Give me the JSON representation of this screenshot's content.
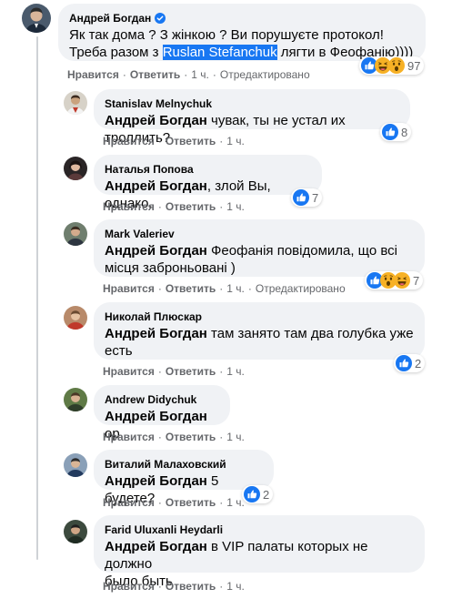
{
  "actions": {
    "like": "Нравится",
    "reply": "Ответить",
    "sep": "·",
    "edited": "Отредактировано"
  },
  "colors": {
    "like_blue": "#1877f2",
    "haha_yellow": "#f7b125",
    "bubble": "#f0f2f5",
    "meta_gray": "#65676b"
  },
  "comments": [
    {
      "author": "Андрей Богдан",
      "verified": true,
      "line1": "Як так дома ? З жінкою ? Ви порушуєте протокол!",
      "line2_before": "Треба разом з ",
      "tag": "Ruslan Stefanchuk",
      "line2_after": " лягти в Феофанію))))",
      "time": "1 ч.",
      "reactions": [
        "like-icon",
        "haha-icon",
        "wow-icon"
      ],
      "count": "97"
    },
    {
      "author": "Stanislav Melnychuk",
      "mention": "Андрей Богдан",
      "text": " чувак, ты не устал их троллить?",
      "time": "1 ч.",
      "reactions": [
        "like-icon"
      ],
      "count": "8"
    },
    {
      "author": "Наталья Попова",
      "mention": "Андрей Богдан",
      "text": ", злой Вы, однако.",
      "time": "1 ч.",
      "reactions": [
        "like-icon"
      ],
      "count": "7"
    },
    {
      "author": "Mark Valeriev",
      "mention": "Андрей Богдан",
      "text_line1": " Феофанія повідомила, що всі",
      "text_line2": "місця заброньовані )",
      "time": "1 ч.",
      "reactions": [
        "like-icon",
        "wow-icon",
        "haha-icon"
      ],
      "count": "7"
    },
    {
      "author": "Николай Плюскар",
      "mention": "Андрей Богдан",
      "text_line1": " там занято там два голубка уже",
      "text_line2": "есть",
      "time": "1 ч.",
      "reactions": [
        "like-icon"
      ],
      "count": "2"
    },
    {
      "author": "Andrew Didychuk",
      "mention": "Андрей Богдан",
      "text": " ор",
      "time": "1 ч."
    },
    {
      "author": "Виталий Малаховский",
      "mention": "Андрей Богдан",
      "text": " 5 будете?",
      "time": "1 ч.",
      "reactions": [
        "like-icon"
      ],
      "count": "2"
    },
    {
      "author": "Farid Uluxanli Heydarli",
      "mention": "Андрей Богдан",
      "text_line1": " в VIP палаты которых не должно",
      "text_line2": "было быть",
      "time": "1 ч."
    }
  ]
}
